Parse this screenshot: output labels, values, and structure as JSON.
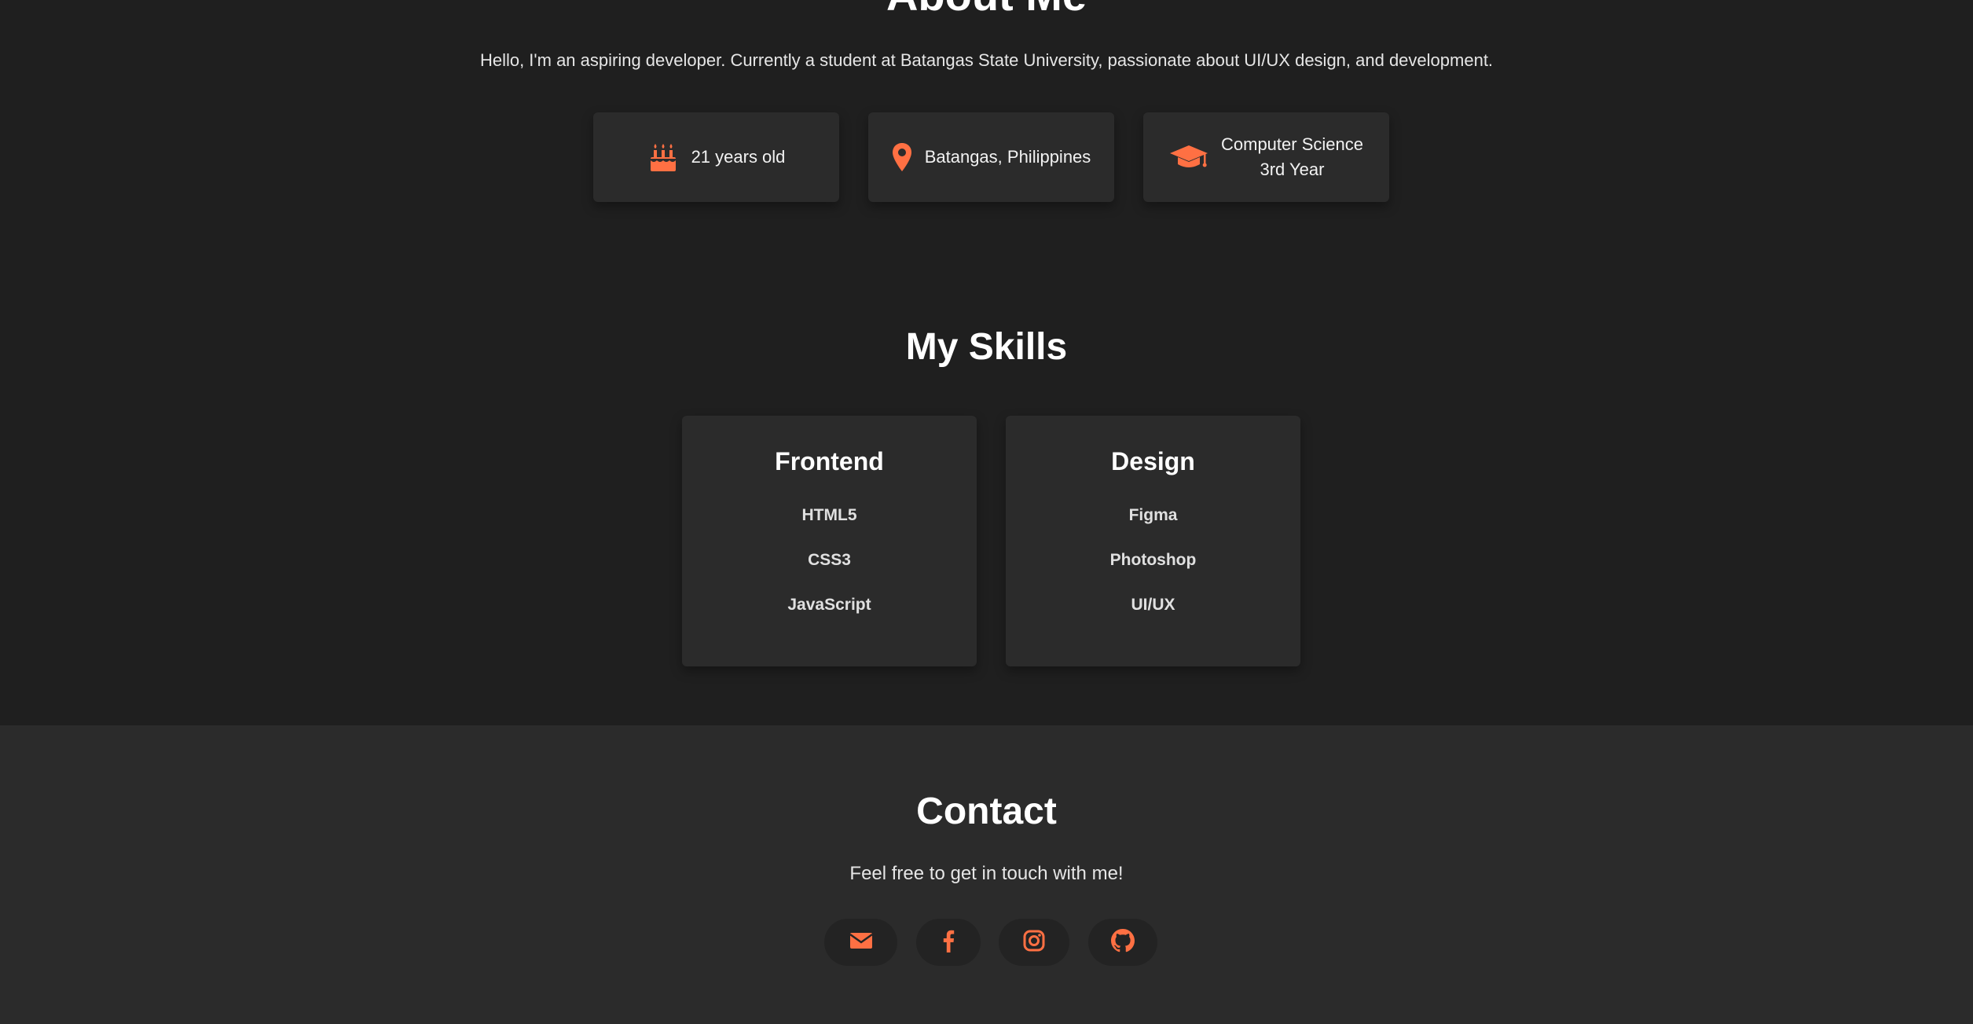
{
  "about": {
    "title": "About Me",
    "description": "Hello, I'm an aspiring developer. Currently a student at Batangas State University, passionate about UI/UX design, and development.",
    "cards": [
      {
        "icon": "birthday-cake-icon",
        "text": "21 years old"
      },
      {
        "icon": "map-marker-icon",
        "text": "Batangas, Philippines"
      },
      {
        "icon": "graduation-cap-icon",
        "line1": "Computer Science",
        "line2": "3rd Year"
      }
    ]
  },
  "skills": {
    "title": "My Skills",
    "groups": [
      {
        "title": "Frontend",
        "items": [
          "HTML5",
          "CSS3",
          "JavaScript"
        ]
      },
      {
        "title": "Design",
        "items": [
          "Figma",
          "Photoshop",
          "UI/UX"
        ]
      }
    ]
  },
  "contact": {
    "title": "Contact",
    "subtitle": "Feel free to get in touch with me!",
    "socials": [
      {
        "icon": "envelope-icon"
      },
      {
        "icon": "facebook-icon"
      },
      {
        "icon": "instagram-icon"
      },
      {
        "icon": "github-icon"
      }
    ]
  },
  "colors": {
    "accent": "#ff7043",
    "background": "#1f1f1f",
    "card": "#2b2b2b",
    "contact_background": "#2b2b2b"
  }
}
